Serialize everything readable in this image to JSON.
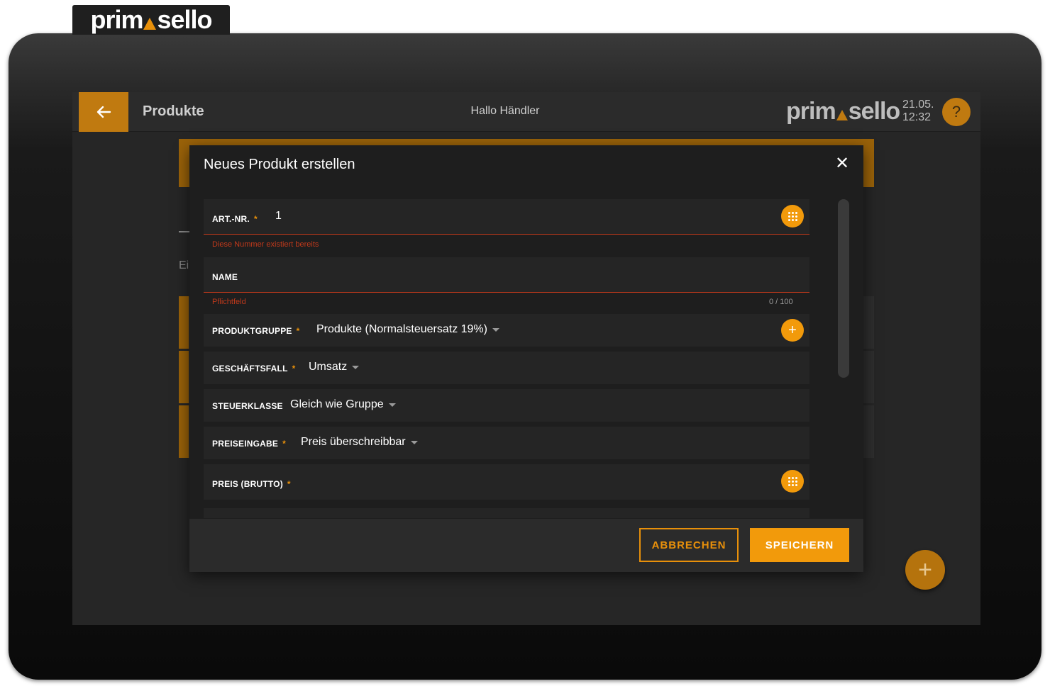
{
  "brand": {
    "logo_left": "prim",
    "logo_right": "sello",
    "accent": "#e8900a"
  },
  "appbar": {
    "back_icon": "arrow-left-icon",
    "title": "Produkte",
    "greeting": "Hallo Händler",
    "date": "21.05.",
    "time": "12:32",
    "help_label": "?"
  },
  "background": {
    "partial_text": "Ei",
    "fab_label": "+"
  },
  "dialog": {
    "title": "Neues Produkt erstellen",
    "close_label": "✕",
    "fields": {
      "art_nr": {
        "label": "ART.-NR.",
        "required": "*",
        "value": "1",
        "error": "Diese Nummer existiert bereits"
      },
      "name": {
        "label": "NAME",
        "value": "",
        "error": "Pflichtfeld",
        "counter": "0 / 100"
      },
      "produktgruppe": {
        "label": "PRODUKTGRUPPE",
        "required": "*",
        "value": "Produkte (Normalsteuersatz 19%)",
        "add_label": "+"
      },
      "geschaeftsfall": {
        "label": "GESCHÄFTSFALL",
        "required": "*",
        "value": "Umsatz"
      },
      "steuerklasse": {
        "label": "STEUERKLASSE",
        "value": "Gleich wie Gruppe"
      },
      "preiseingabe": {
        "label": "PREISEINGABE",
        "required": "*",
        "value": "Preis überschreibbar"
      },
      "preis": {
        "label": "PREIS (BRUTTO)",
        "required": "*",
        "value": ""
      }
    },
    "cancel_label": "ABBRECHEN",
    "save_label": "SPEICHERN"
  }
}
